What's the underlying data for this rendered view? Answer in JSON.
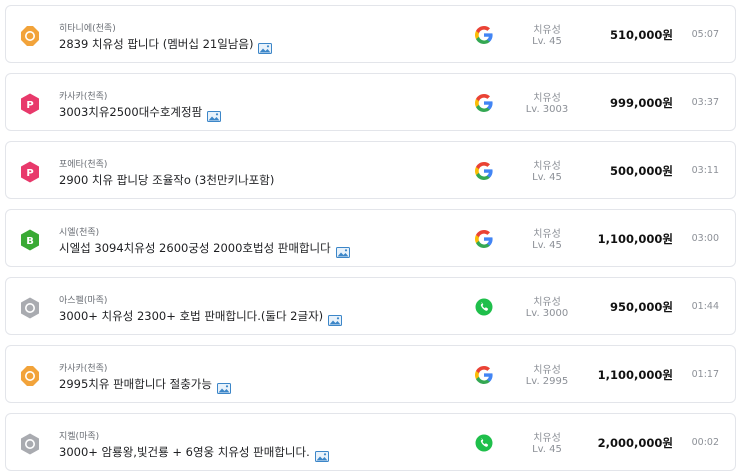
{
  "listings": [
    {
      "badge_icon": "gold-octagon-badge-icon",
      "badge_color": "#f2a33a",
      "badge_letter": "",
      "server": "히타니에(천족)",
      "title": "2839 치유성 팝니다 (멤버십 21일남음)",
      "has_image": true,
      "login_icon": "google-icon",
      "job": "치유성",
      "level": "Lv. 45",
      "price": "510,000원",
      "time": "05:07"
    },
    {
      "badge_icon": "pink-hexagon-p-badge-icon",
      "badge_color": "#e8396b",
      "badge_letter": "P",
      "server": "카사카(천족)",
      "title": "3003치유2500대수호계정팜",
      "has_image": true,
      "login_icon": "google-icon",
      "job": "치유성",
      "level": "Lv. 3003",
      "price": "999,000원",
      "time": "03:37"
    },
    {
      "badge_icon": "pink-hexagon-p-badge-icon",
      "badge_color": "#e8396b",
      "badge_letter": "P",
      "server": "포에타(천족)",
      "title": "2900 치유 팝니당 조율작o (3천만키나포함)",
      "has_image": false,
      "login_icon": "google-icon",
      "job": "치유성",
      "level": "Lv. 45",
      "price": "500,000원",
      "time": "03:11"
    },
    {
      "badge_icon": "green-hexagon-b-badge-icon",
      "badge_color": "#3aaa35",
      "badge_letter": "B",
      "server": "시엘(천족)",
      "title": "시엘섭 3094치유성 2600궁성 2000호법성 판매합니다",
      "has_image": true,
      "login_icon": "google-icon",
      "job": "치유성",
      "level": "Lv. 45",
      "price": "1,100,000원",
      "time": "03:00"
    },
    {
      "badge_icon": "gray-hexagon-badge-icon",
      "badge_color": "#a9abb0",
      "badge_letter": "",
      "server": "아스펠(마족)",
      "title": "3000+ 치유성 2300+ 호법 판매합니다.(둘다 2글자)",
      "has_image": true,
      "login_icon": "phone-icon",
      "job": "치유성",
      "level": "Lv. 3000",
      "price": "950,000원",
      "time": "01:44"
    },
    {
      "badge_icon": "gold-octagon-badge-icon",
      "badge_color": "#f2a33a",
      "badge_letter": "",
      "server": "카사카(천족)",
      "title": "2995치유 판매합니다 절충가능",
      "has_image": true,
      "login_icon": "google-icon",
      "job": "치유성",
      "level": "Lv. 2995",
      "price": "1,100,000원",
      "time": "01:17"
    },
    {
      "badge_icon": "gray-hexagon-badge-icon",
      "badge_color": "#a9abb0",
      "badge_letter": "",
      "server": "지켈(마족)",
      "title": "3000+ 암룡왕,빛건룡 + 6영웅 치유성 판매합니다.",
      "has_image": true,
      "login_icon": "phone-icon",
      "job": "치유성",
      "level": "Lv. 45",
      "price": "2,000,000원",
      "time": "00:02"
    }
  ],
  "colors": {
    "card_border": "#e3e5ea",
    "price_text": "#111111",
    "muted_text": "#8c9097",
    "phone_green": "#1fbf4b"
  }
}
